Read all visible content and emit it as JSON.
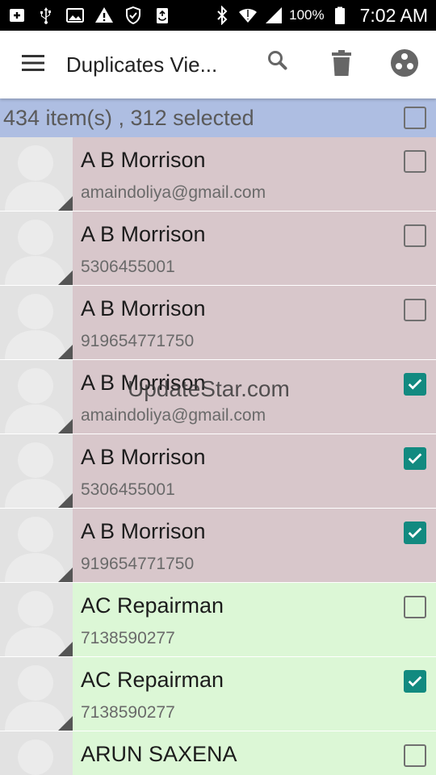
{
  "status_bar": {
    "left_icons": [
      "add-box-icon",
      "usb-icon",
      "image-icon",
      "warning-icon",
      "shield-icon",
      "recycle-icon"
    ],
    "right_icons": [
      "bluetooth-icon",
      "wifi-icon",
      "cell-signal-icon",
      "battery-icon"
    ],
    "battery_percent": "100%",
    "time": "7:02 AM"
  },
  "app_bar": {
    "title": "Duplicates Vie...",
    "actions": [
      "search-icon",
      "delete-icon",
      "more-options-icon"
    ]
  },
  "summary": {
    "text": "434 item(s) , 312 selected",
    "checked": false
  },
  "colors": {
    "duplicate_row_bg": "#d8c7cb",
    "unique_row_bg": "#dcf7d6",
    "summary_bg": "#aebee2",
    "checkbox_checked": "#128a80",
    "status_bar_bg": "#000000"
  },
  "rows": [
    {
      "name": "A B Morrison",
      "detail": "amaindoliya@gmail.com",
      "checked": false,
      "group": "duplicate"
    },
    {
      "name": "A B Morrison",
      "detail": "5306455001",
      "checked": false,
      "group": "duplicate"
    },
    {
      "name": "A B Morrison",
      "detail": "919654771750",
      "checked": false,
      "group": "duplicate"
    },
    {
      "name": "A B Morrison",
      "detail": "amaindoliya@gmail.com",
      "checked": true,
      "group": "duplicate"
    },
    {
      "name": "A B Morrison",
      "detail": "5306455001",
      "checked": true,
      "group": "duplicate"
    },
    {
      "name": "A B Morrison",
      "detail": "919654771750",
      "checked": true,
      "group": "duplicate"
    },
    {
      "name": "AC Repairman",
      "detail": "7138590277",
      "checked": false,
      "group": "unique"
    },
    {
      "name": "AC Repairman",
      "detail": "7138590277",
      "checked": true,
      "group": "unique"
    },
    {
      "name": "ARUN SAXENA",
      "detail": "",
      "checked": false,
      "group": "unique"
    }
  ],
  "watermark": "UpdateStar.com"
}
